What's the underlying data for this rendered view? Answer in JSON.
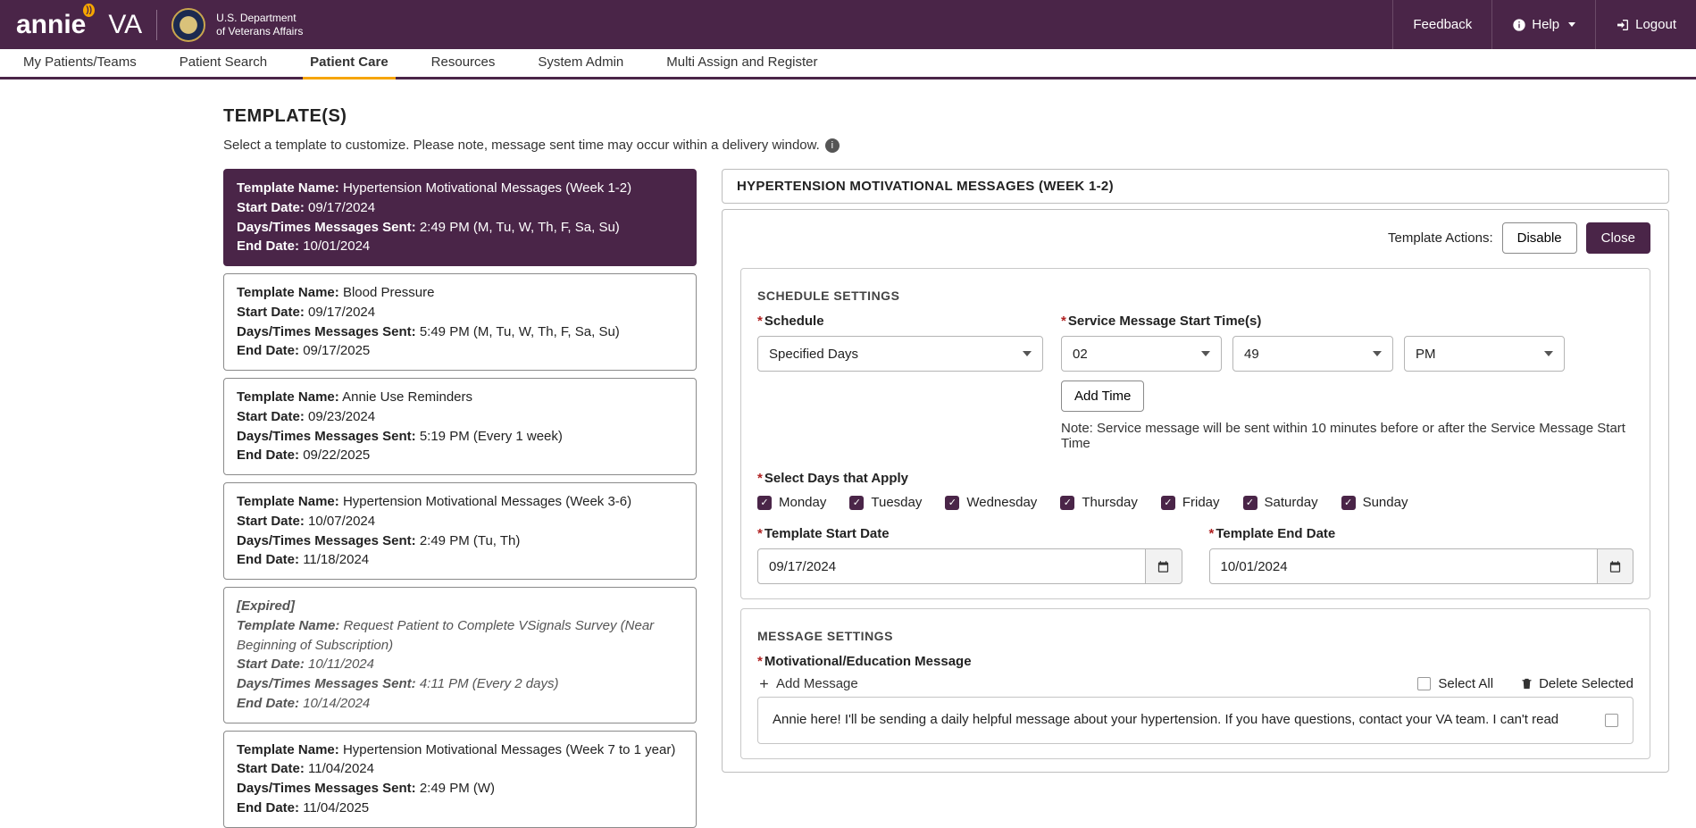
{
  "header": {
    "brand_main": "annie",
    "brand_suffix": "VA",
    "dept_line1": "U.S. Department",
    "dept_line2": "of Veterans Affairs",
    "feedback": "Feedback",
    "help": "Help",
    "logout": "Logout"
  },
  "nav": {
    "items": [
      "My Patients/Teams",
      "Patient Search",
      "Patient Care",
      "Resources",
      "System Admin",
      "Multi Assign and Register"
    ],
    "active_index": 2
  },
  "templates": {
    "heading": "TEMPLATE(S)",
    "sub": "Select a template to customize. Please note, message sent time may occur within a delivery window.",
    "labels": {
      "name": "Template Name:",
      "start": "Start Date:",
      "sent": "Days/Times Messages Sent:",
      "end": "End Date:",
      "expired": "[Expired]"
    },
    "cards": [
      {
        "selected": true,
        "expired": false,
        "name": "Hypertension Motivational Messages (Week 1-2)",
        "start": "09/17/2024",
        "sent": "2:49 PM (M, Tu, W, Th, F, Sa, Su)",
        "end": "10/01/2024"
      },
      {
        "selected": false,
        "expired": false,
        "name": "Blood Pressure",
        "start": "09/17/2024",
        "sent": "5:49 PM (M, Tu, W, Th, F, Sa, Su)",
        "end": "09/17/2025"
      },
      {
        "selected": false,
        "expired": false,
        "name": "Annie Use Reminders",
        "start": "09/23/2024",
        "sent": "5:19 PM (Every 1 week)",
        "end": "09/22/2025"
      },
      {
        "selected": false,
        "expired": false,
        "name": "Hypertension Motivational Messages (Week 3-6)",
        "start": "10/07/2024",
        "sent": "2:49 PM (Tu, Th)",
        "end": "11/18/2024"
      },
      {
        "selected": false,
        "expired": true,
        "name": "Request Patient to Complete VSignals Survey (Near Beginning of Subscription)",
        "start": "10/11/2024",
        "sent": "4:11 PM (Every 2 days)",
        "end": "10/14/2024"
      },
      {
        "selected": false,
        "expired": false,
        "name": "Hypertension Motivational Messages (Week 7 to 1 year)",
        "start": "11/04/2024",
        "sent": "2:49 PM (W)",
        "end": "11/04/2025"
      }
    ]
  },
  "panel": {
    "title": "HYPERTENSION MOTIVATIONAL MESSAGES (WEEK 1-2)",
    "actions_label": "Template Actions:",
    "disable": "Disable",
    "close": "Close",
    "schedule": {
      "heading": "SCHEDULE SETTINGS",
      "schedule_label": "Schedule",
      "schedule_value": "Specified Days",
      "start_times_label": "Service Message Start Time(s)",
      "hour": "02",
      "minute": "49",
      "ampm": "PM",
      "add_time": "Add Time",
      "note": "Note: Service message will be sent within 10 minutes before or after the Service Message Start Time",
      "days_label": "Select Days that Apply",
      "days": [
        "Monday",
        "Tuesday",
        "Wednesday",
        "Thursday",
        "Friday",
        "Saturday",
        "Sunday"
      ],
      "start_date_label": "Template Start Date",
      "start_date": "09/17/2024",
      "end_date_label": "Template End Date",
      "end_date": "10/01/2024"
    },
    "messages": {
      "heading": "MESSAGE SETTINGS",
      "type_label": "Motivational/Education Message",
      "add": "Add Message",
      "select_all": "Select All",
      "delete_selected": "Delete Selected",
      "body": "Annie here! I'll be sending a daily helpful message about your hypertension. If you have questions, contact your VA team. I can't read"
    }
  }
}
